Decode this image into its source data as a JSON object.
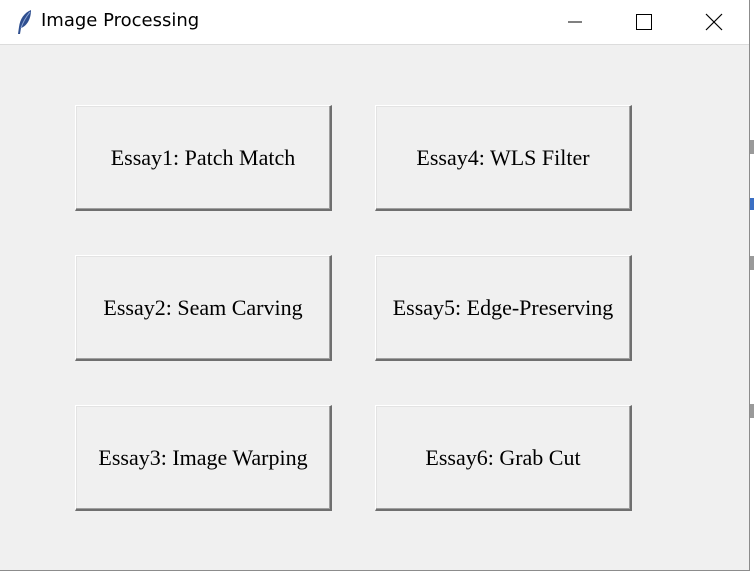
{
  "window": {
    "title": "Image Processing"
  },
  "titlebar": {
    "app_icon": "feather-icon",
    "controls": [
      "minimize-icon",
      "maximize-icon",
      "close-icon"
    ]
  },
  "buttons": [
    {
      "label": "Essay1: Patch Match"
    },
    {
      "label": "Essay4: WLS Filter"
    },
    {
      "label": "Essay2: Seam Carving"
    },
    {
      "label": "Essay5: Edge-Preserving"
    },
    {
      "label": "Essay3: Image Warping"
    },
    {
      "label": "Essay6: Grab Cut"
    }
  ],
  "colors": {
    "window_bg": "#f0f0f0",
    "titlebar_bg": "#ffffff",
    "icon_blue": "#2f4f8f"
  }
}
